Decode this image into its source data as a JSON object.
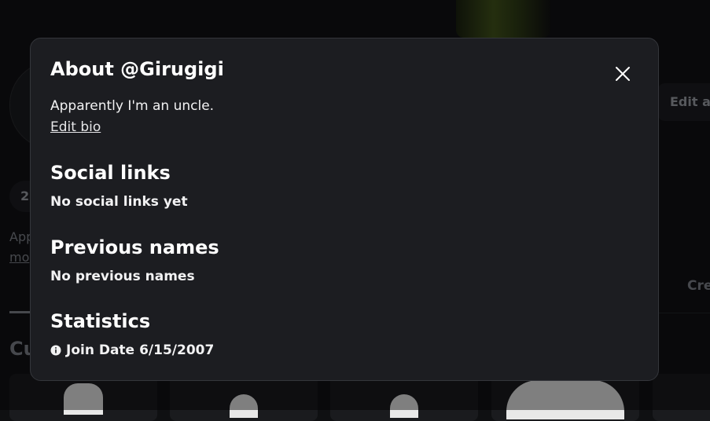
{
  "background": {
    "edit_avatar_label": "Edit av",
    "friends_count": "2",
    "about_preview": "App",
    "more_link": "mo",
    "creations_tab": "Cre",
    "section_heading": "Cu"
  },
  "modal": {
    "title": "About @Girugigi",
    "bio": "Apparently I'm an uncle.",
    "edit_bio_label": "Edit bio",
    "close_icon": "close-icon",
    "sections": {
      "social_links": {
        "title": "Social links",
        "value": "No social links yet"
      },
      "previous_names": {
        "title": "Previous names",
        "value": "No previous names"
      },
      "statistics": {
        "title": "Statistics",
        "join_label": "Join Date",
        "join_date": "6/15/2007",
        "icon": "info-icon"
      }
    }
  }
}
